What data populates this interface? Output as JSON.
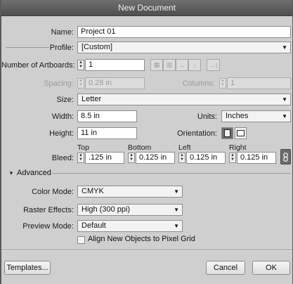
{
  "window": {
    "title": "New Document"
  },
  "name": {
    "label": "Name:",
    "value": "Project 01"
  },
  "profile": {
    "label": "Profile:",
    "value": "[Custom]"
  },
  "artboards": {
    "label": "Number of Artboards:",
    "value": "1"
  },
  "spacing": {
    "label": "Spacing:",
    "value": "0.28 in"
  },
  "columns": {
    "label": "Columns:",
    "value": "1"
  },
  "size": {
    "label": "Size:",
    "value": "Letter"
  },
  "width": {
    "label": "Width:",
    "value": "8.5 in"
  },
  "units": {
    "label": "Units:",
    "value": "Inches"
  },
  "height": {
    "label": "Height:",
    "value": "11 in"
  },
  "orientation": {
    "label": "Orientation:"
  },
  "bleed": {
    "label": "Bleed:",
    "top_label": "Top",
    "top_value": ".125 in",
    "bottom_label": "Bottom",
    "bottom_value": "0.125 in",
    "left_label": "Left",
    "left_value": "0.125 in",
    "right_label": "Right",
    "right_value": "0.125 in"
  },
  "advanced": {
    "label": "Advanced",
    "color_mode": {
      "label": "Color Mode:",
      "value": "CMYK"
    },
    "raster_effects": {
      "label": "Raster Effects:",
      "value": "High (300 ppi)"
    },
    "preview_mode": {
      "label": "Preview Mode:",
      "value": "Default"
    },
    "align_pixel_grid": {
      "label": "Align New Objects to Pixel Grid",
      "checked": false
    }
  },
  "buttons": {
    "templates": "Templates...",
    "cancel": "Cancel",
    "ok": "OK"
  },
  "icons": {
    "spinner": "spinner-arrows-icon",
    "dropdown": "dropdown-arrow-icon",
    "disclosure": "disclosure-triangle-icon",
    "link": "chain-link-icon"
  }
}
